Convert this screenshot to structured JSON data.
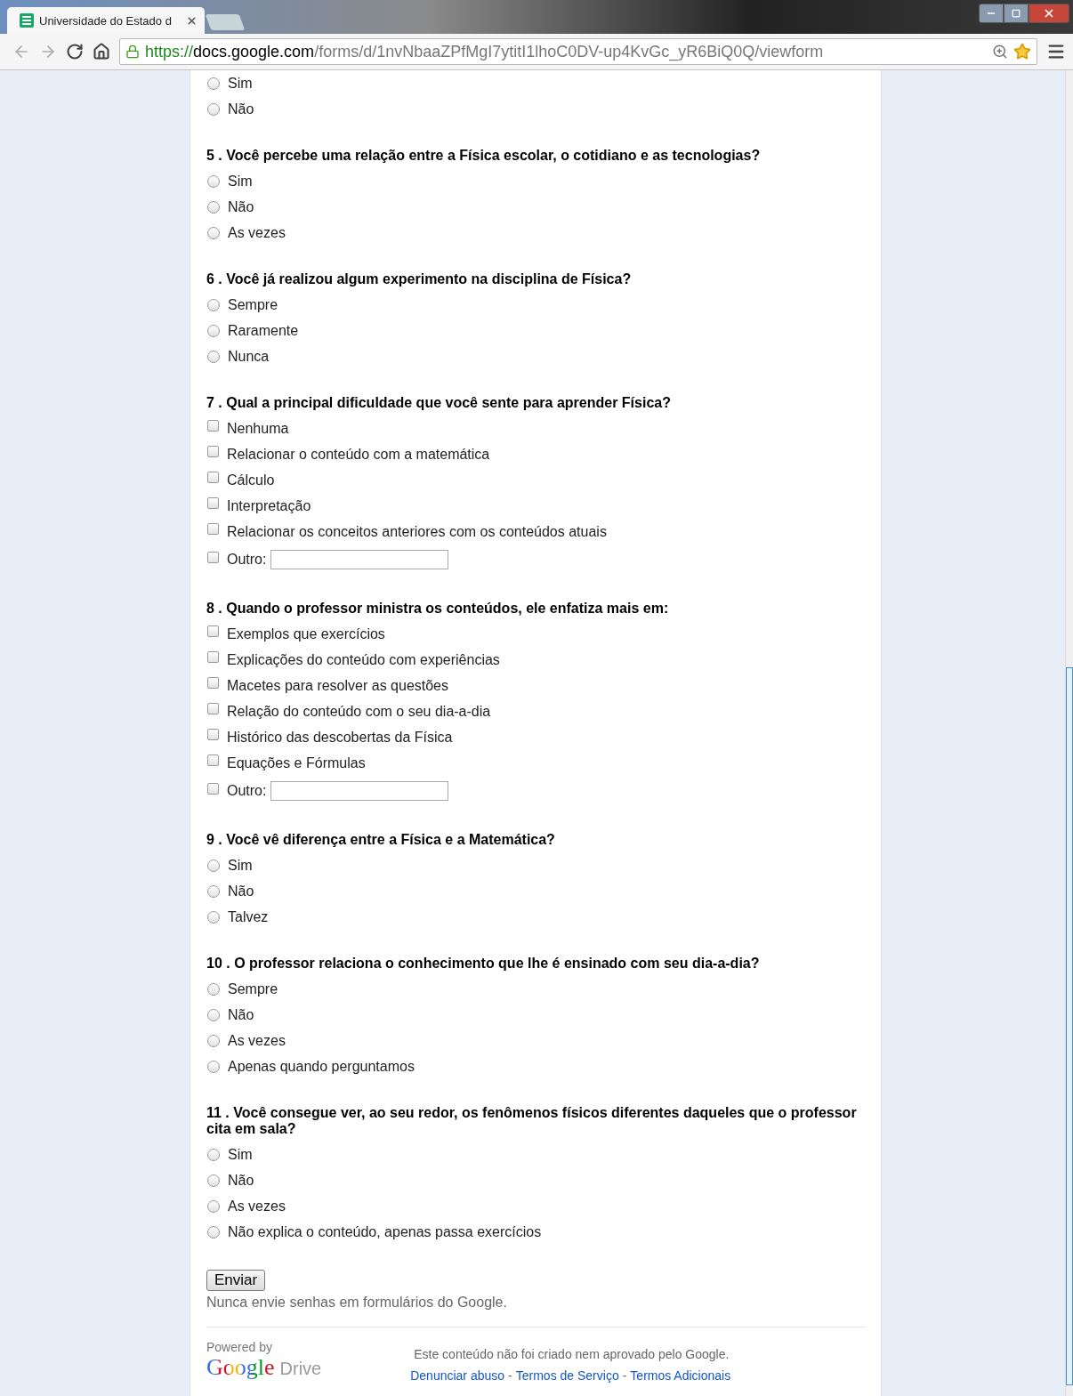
{
  "browser": {
    "tab_title": "Universidade do Estado d",
    "url": {
      "scheme": "https://",
      "host": "docs.google.com",
      "path": "/forms/d/1nvNbaaZPfMgI7ytitI1lhoC0DV-up4KvGc_yR6BiQ0Q/viewform"
    }
  },
  "questions": [
    {
      "kind": "radio",
      "options": [
        {
          "label": "Sim",
          "selected": false
        },
        {
          "label": "Não",
          "selected": false
        }
      ]
    },
    {
      "kind": "radio",
      "title": "5 . Você percebe uma relação entre a Física escolar, o cotidiano e as tecnologias?",
      "options": [
        {
          "label": "Sim",
          "selected": false
        },
        {
          "label": "Não",
          "selected": false
        },
        {
          "label": "As vezes",
          "selected": false
        }
      ]
    },
    {
      "kind": "radio",
      "title": "6 . Você já realizou algum experimento na disciplina de Física?",
      "options": [
        {
          "label": "Sempre",
          "selected": false
        },
        {
          "label": "Raramente",
          "selected": false
        },
        {
          "label": "Nunca",
          "selected": false
        }
      ]
    },
    {
      "kind": "checkbox",
      "title": "7 . Qual a principal dificuldade que você sente para aprender Física?",
      "options": [
        {
          "label": "Nenhuma",
          "selected": false
        },
        {
          "label": "Relacionar o conteúdo com a matemática",
          "selected": false
        },
        {
          "label": "Cálculo",
          "selected": false
        },
        {
          "label": "Interpretação",
          "selected": false
        },
        {
          "label": "Relacionar os conceitos anteriores com os conteúdos atuais",
          "selected": false
        }
      ],
      "other": {
        "label": "Outro:",
        "selected": false
      }
    },
    {
      "kind": "checkbox",
      "title": "8 . Quando o professor ministra os conteúdos, ele enfatiza mais em:",
      "options": [
        {
          "label": "Exemplos que exercícios",
          "selected": false
        },
        {
          "label": "Explicações do conteúdo com experiências",
          "selected": false
        },
        {
          "label": "Macetes para resolver as questões",
          "selected": false
        },
        {
          "label": "Relação do conteúdo com o seu dia-a-dia",
          "selected": false
        },
        {
          "label": "Histórico das descobertas da Física",
          "selected": false
        },
        {
          "label": "Equações e Fórmulas",
          "selected": false
        }
      ],
      "other": {
        "label": "Outro:",
        "selected": false
      }
    },
    {
      "kind": "radio",
      "title": "9 . Você vê diferença entre a Física e a Matemática?",
      "options": [
        {
          "label": "Sim",
          "selected": false
        },
        {
          "label": "Não",
          "selected": false
        },
        {
          "label": "Talvez",
          "selected": false
        }
      ]
    },
    {
      "kind": "radio",
      "title": "10 . O professor relaciona o conhecimento que lhe é ensinado com seu dia-a-dia?",
      "options": [
        {
          "label": "Sempre",
          "selected": false
        },
        {
          "label": "Não",
          "selected": false
        },
        {
          "label": "As vezes",
          "selected": false
        },
        {
          "label": "Apenas quando perguntamos",
          "selected": false
        }
      ]
    },
    {
      "kind": "radio",
      "title": "11 . Você consegue ver, ao seu redor, os fenômenos físicos diferentes daqueles que o professor cita em sala?",
      "options": [
        {
          "label": "Sim",
          "selected": false
        },
        {
          "label": "Não",
          "selected": false
        },
        {
          "label": "As vezes",
          "selected": false
        },
        {
          "label": "Não explica o conteúdo, apenas passa exercícios",
          "selected": false
        }
      ]
    }
  ],
  "submit": "Enviar",
  "warning": "Nunca envie senhas em formulários do Google.",
  "footer": {
    "powered_by": "Powered by",
    "logo_google": "Google",
    "logo_drive": "Drive",
    "disclaimer": "Este conteúdo não foi criado nem aprovado pelo Google.",
    "separator": "-",
    "links": [
      "Denunciar abuso",
      "Termos de Serviço",
      "Termos Adicionais"
    ]
  }
}
